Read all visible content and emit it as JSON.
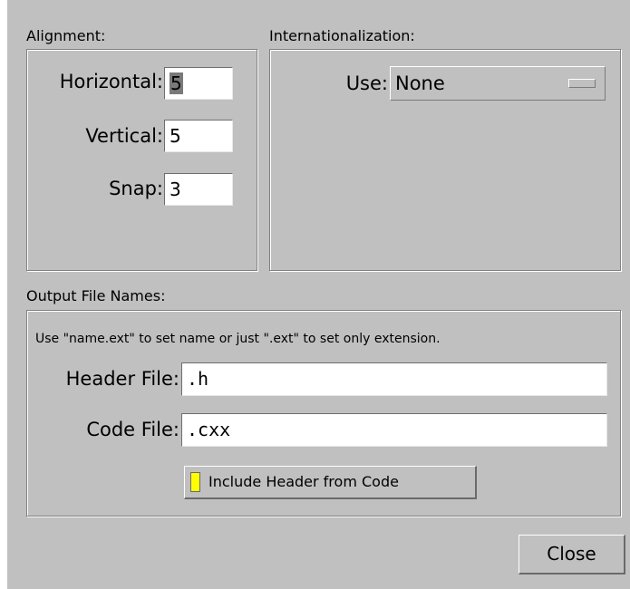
{
  "alignment": {
    "title": "Alignment:",
    "horizontal_label": "Horizontal:",
    "horizontal_value": "5",
    "vertical_label": "Vertical:",
    "vertical_value": "5",
    "snap_label": "Snap:",
    "snap_value": "3"
  },
  "i18n": {
    "title": "Internationalization:",
    "use_label": "Use:",
    "use_value": "None"
  },
  "output": {
    "title": "Output File Names:",
    "hint": "Use \"name.ext\" to set name or just \".ext\" to set only extension.",
    "header_label": "Header File:",
    "header_value": ".h",
    "code_label": "Code File:",
    "code_value": ".cxx",
    "include_label": "Include Header from Code",
    "include_checked": true
  },
  "close_label": "Close"
}
